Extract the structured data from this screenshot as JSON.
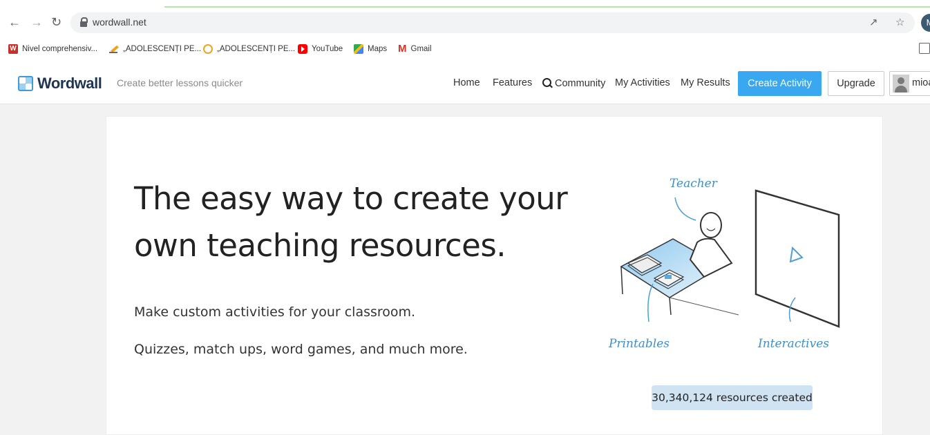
{
  "browser": {
    "url": "wordwall.net",
    "profile_initial": "M",
    "bookmarks": [
      {
        "label": "Nivel comprehensiv...",
        "icon": "wordwall-red-icon"
      },
      {
        "label": "„ADOLESCENȚI PE...",
        "icon": "pencil-icon"
      },
      {
        "label": "„ADOLESCENȚI PE...",
        "icon": "clock-icon"
      },
      {
        "label": "YouTube",
        "icon": "youtube-icon"
      },
      {
        "label": "Maps",
        "icon": "maps-icon"
      },
      {
        "label": "Gmail",
        "icon": "gmail-icon"
      }
    ]
  },
  "header": {
    "logo": "Wordwall",
    "tagline": "Create better lessons quicker",
    "nav": {
      "home": "Home",
      "features": "Features",
      "community": "Community",
      "my_activities": "My Activities",
      "my_results": "My Results"
    },
    "create_activity": "Create Activity",
    "upgrade": "Upgrade",
    "user_name": "mioa"
  },
  "hero": {
    "title_line1": "The easy way to create your",
    "title_line2": "own teaching resources.",
    "subtitle1": "Make custom activities for your classroom.",
    "subtitle2": "Quizzes, match ups, word games, and much more.",
    "illustration": {
      "teacher_label": "Teacher",
      "printables_label": "Printables",
      "interactives_label": "Interactives"
    },
    "counter": "30,340,124 resources created"
  },
  "colors": {
    "accent": "#3aa8f0",
    "logo_blue": "#3f9ad8",
    "counter_bg": "#cfe3f3"
  }
}
